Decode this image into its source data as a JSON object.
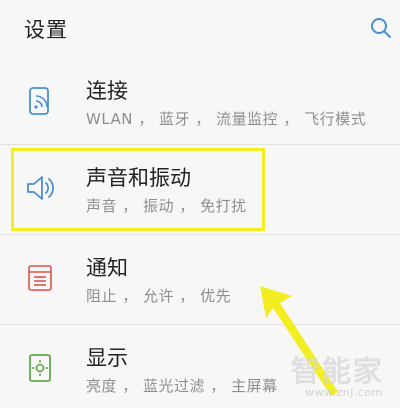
{
  "header": {
    "title": "设置",
    "search_icon": "search-icon"
  },
  "items": [
    {
      "title": "连接",
      "subtitle": "WLAN ， 蓝牙 ， 流量监控 ， 飞行模式",
      "icon": "connection-icon"
    },
    {
      "title": "声音和振动",
      "subtitle": "声音 ， 振动 ， 免打扰",
      "icon": "speaker-icon"
    },
    {
      "title": "通知",
      "subtitle": "阻止 ， 允许 ， 优先",
      "icon": "notification-icon"
    },
    {
      "title": "显示",
      "subtitle": "亮度 ， 蓝光过滤 ， 主屏幕",
      "icon": "display-icon"
    }
  ],
  "watermark": {
    "text": "智能家",
    "url": "www.znj.com"
  },
  "colors": {
    "highlight": "#f2ee22",
    "icon_accent": "#4a8fd4",
    "icon_red": "#e0675e",
    "icon_green": "#62a84b",
    "arrow": "#f2ee22"
  }
}
